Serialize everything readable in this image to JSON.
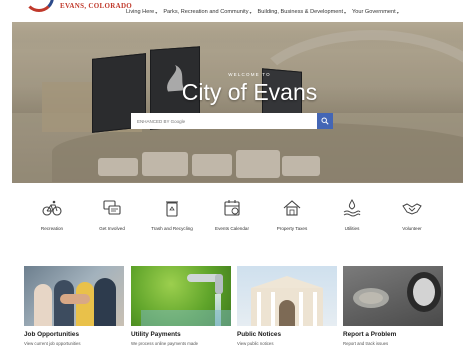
{
  "header": {
    "logo_text": "EVANS, COLORADO",
    "nav": [
      {
        "label": "Living Here"
      },
      {
        "label": "Parks, Recreation and Community"
      },
      {
        "label": "Building, Business & Development"
      },
      {
        "label": "Your Government"
      }
    ]
  },
  "hero": {
    "welcome": "WELCOME TO",
    "title": "City of Evans",
    "search": {
      "placeholder": "ENHANCED BY Google"
    }
  },
  "quick_links": [
    {
      "label": "Recreation",
      "icon": "bicycle-icon"
    },
    {
      "label": "Get Involved",
      "icon": "chat-bubbles-icon"
    },
    {
      "label": "Trash and Recycling",
      "icon": "trash-recycle-icon"
    },
    {
      "label": "Events Calendar",
      "icon": "calendar-icon"
    },
    {
      "label": "Property Taxes",
      "icon": "house-dollar-icon"
    },
    {
      "label": "Utilities",
      "icon": "water-drop-icon"
    },
    {
      "label": "Volunteer",
      "icon": "handshake-icon"
    }
  ],
  "cards": [
    {
      "title": "Job Opportunities",
      "sub": "View current job opportunities"
    },
    {
      "title": "Utility Payments",
      "sub": "We process online payments made"
    },
    {
      "title": "Public Notices",
      "sub": "View public notices"
    },
    {
      "title": "Report a Problem",
      "sub": "Report and track issues"
    }
  ],
  "colors": {
    "accent": "#4466b5",
    "logo_red": "#c0392b",
    "logo_blue": "#2c4a8a"
  }
}
